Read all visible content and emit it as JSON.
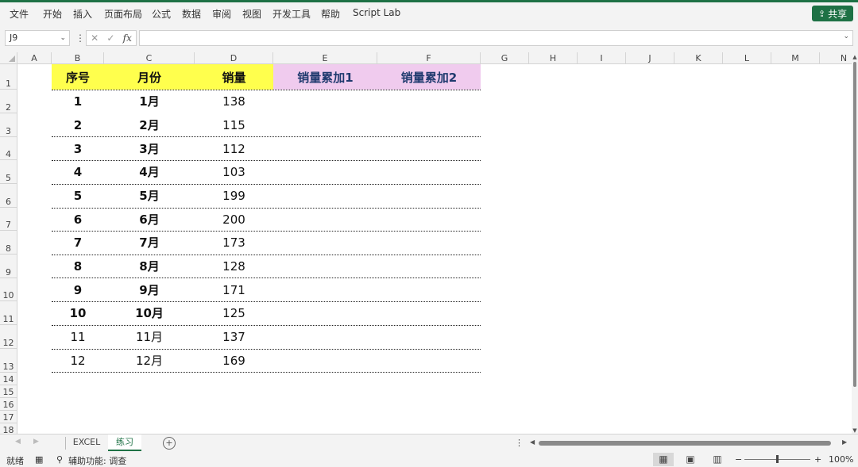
{
  "ribbon": {
    "menu": [
      "文件",
      "开始",
      "插入",
      "页面布局",
      "公式",
      "数据",
      "审阅",
      "视图",
      "开发工具",
      "帮助",
      "Script Lab"
    ],
    "share_label": "共享",
    "accent": "#1e7145"
  },
  "formula_bar": {
    "name_box": "J9",
    "formula": ""
  },
  "sheet": {
    "columns": [
      "A",
      "B",
      "C",
      "D",
      "E",
      "F",
      "G",
      "H",
      "I",
      "J",
      "K",
      "L",
      "M",
      "N"
    ],
    "rows": [
      "1",
      "2",
      "3",
      "4",
      "5",
      "6",
      "7",
      "8",
      "9",
      "10",
      "11",
      "12",
      "13",
      "14",
      "15",
      "16",
      "17",
      "18"
    ],
    "headers": {
      "seq": "序号",
      "month": "月份",
      "sales": "销量",
      "cum1": "销量累加1",
      "cum2": "销量累加2"
    },
    "data": [
      {
        "seq": "1",
        "month": "1月",
        "sales": "138"
      },
      {
        "seq": "2",
        "month": "2月",
        "sales": "115"
      },
      {
        "seq": "3",
        "month": "3月",
        "sales": "112"
      },
      {
        "seq": "4",
        "month": "4月",
        "sales": "103"
      },
      {
        "seq": "5",
        "month": "5月",
        "sales": "199"
      },
      {
        "seq": "6",
        "month": "6月",
        "sales": "200"
      },
      {
        "seq": "7",
        "month": "7月",
        "sales": "173"
      },
      {
        "seq": "8",
        "month": "8月",
        "sales": "128"
      },
      {
        "seq": "9",
        "month": "9月",
        "sales": "171"
      },
      {
        "seq": "10",
        "month": "10月",
        "sales": "125"
      },
      {
        "seq": "11",
        "month": "11月",
        "sales": "137"
      },
      {
        "seq": "12",
        "month": "12月",
        "sales": "169"
      }
    ],
    "colors": {
      "header_yellow": "#ffff4d",
      "header_pink": "#f0cbee",
      "header_pink_text": "#1f3a6e"
    }
  },
  "tabs": [
    {
      "label": "EXCEL",
      "active": false
    },
    {
      "label": "练习",
      "active": true
    }
  ],
  "status": {
    "ready": "就绪",
    "accessibility": "辅助功能: 调查",
    "zoom": "100%",
    "zoom_minus": "−",
    "zoom_plus": "+"
  }
}
